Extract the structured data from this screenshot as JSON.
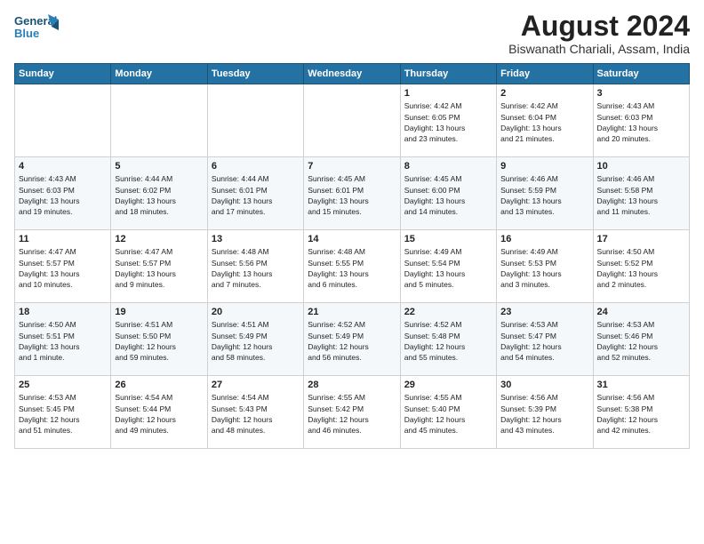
{
  "logo": {
    "line1": "General",
    "line2": "Blue"
  },
  "title": "August 2024",
  "location": "Biswanath Chariali, Assam, India",
  "days_of_week": [
    "Sunday",
    "Monday",
    "Tuesday",
    "Wednesday",
    "Thursday",
    "Friday",
    "Saturday"
  ],
  "weeks": [
    [
      {
        "day": "",
        "info": ""
      },
      {
        "day": "",
        "info": ""
      },
      {
        "day": "",
        "info": ""
      },
      {
        "day": "",
        "info": ""
      },
      {
        "day": "1",
        "info": "Sunrise: 4:42 AM\nSunset: 6:05 PM\nDaylight: 13 hours\nand 23 minutes."
      },
      {
        "day": "2",
        "info": "Sunrise: 4:42 AM\nSunset: 6:04 PM\nDaylight: 13 hours\nand 21 minutes."
      },
      {
        "day": "3",
        "info": "Sunrise: 4:43 AM\nSunset: 6:03 PM\nDaylight: 13 hours\nand 20 minutes."
      }
    ],
    [
      {
        "day": "4",
        "info": "Sunrise: 4:43 AM\nSunset: 6:03 PM\nDaylight: 13 hours\nand 19 minutes."
      },
      {
        "day": "5",
        "info": "Sunrise: 4:44 AM\nSunset: 6:02 PM\nDaylight: 13 hours\nand 18 minutes."
      },
      {
        "day": "6",
        "info": "Sunrise: 4:44 AM\nSunset: 6:01 PM\nDaylight: 13 hours\nand 17 minutes."
      },
      {
        "day": "7",
        "info": "Sunrise: 4:45 AM\nSunset: 6:01 PM\nDaylight: 13 hours\nand 15 minutes."
      },
      {
        "day": "8",
        "info": "Sunrise: 4:45 AM\nSunset: 6:00 PM\nDaylight: 13 hours\nand 14 minutes."
      },
      {
        "day": "9",
        "info": "Sunrise: 4:46 AM\nSunset: 5:59 PM\nDaylight: 13 hours\nand 13 minutes."
      },
      {
        "day": "10",
        "info": "Sunrise: 4:46 AM\nSunset: 5:58 PM\nDaylight: 13 hours\nand 11 minutes."
      }
    ],
    [
      {
        "day": "11",
        "info": "Sunrise: 4:47 AM\nSunset: 5:57 PM\nDaylight: 13 hours\nand 10 minutes."
      },
      {
        "day": "12",
        "info": "Sunrise: 4:47 AM\nSunset: 5:57 PM\nDaylight: 13 hours\nand 9 minutes."
      },
      {
        "day": "13",
        "info": "Sunrise: 4:48 AM\nSunset: 5:56 PM\nDaylight: 13 hours\nand 7 minutes."
      },
      {
        "day": "14",
        "info": "Sunrise: 4:48 AM\nSunset: 5:55 PM\nDaylight: 13 hours\nand 6 minutes."
      },
      {
        "day": "15",
        "info": "Sunrise: 4:49 AM\nSunset: 5:54 PM\nDaylight: 13 hours\nand 5 minutes."
      },
      {
        "day": "16",
        "info": "Sunrise: 4:49 AM\nSunset: 5:53 PM\nDaylight: 13 hours\nand 3 minutes."
      },
      {
        "day": "17",
        "info": "Sunrise: 4:50 AM\nSunset: 5:52 PM\nDaylight: 13 hours\nand 2 minutes."
      }
    ],
    [
      {
        "day": "18",
        "info": "Sunrise: 4:50 AM\nSunset: 5:51 PM\nDaylight: 13 hours\nand 1 minute."
      },
      {
        "day": "19",
        "info": "Sunrise: 4:51 AM\nSunset: 5:50 PM\nDaylight: 12 hours\nand 59 minutes."
      },
      {
        "day": "20",
        "info": "Sunrise: 4:51 AM\nSunset: 5:49 PM\nDaylight: 12 hours\nand 58 minutes."
      },
      {
        "day": "21",
        "info": "Sunrise: 4:52 AM\nSunset: 5:49 PM\nDaylight: 12 hours\nand 56 minutes."
      },
      {
        "day": "22",
        "info": "Sunrise: 4:52 AM\nSunset: 5:48 PM\nDaylight: 12 hours\nand 55 minutes."
      },
      {
        "day": "23",
        "info": "Sunrise: 4:53 AM\nSunset: 5:47 PM\nDaylight: 12 hours\nand 54 minutes."
      },
      {
        "day": "24",
        "info": "Sunrise: 4:53 AM\nSunset: 5:46 PM\nDaylight: 12 hours\nand 52 minutes."
      }
    ],
    [
      {
        "day": "25",
        "info": "Sunrise: 4:53 AM\nSunset: 5:45 PM\nDaylight: 12 hours\nand 51 minutes."
      },
      {
        "day": "26",
        "info": "Sunrise: 4:54 AM\nSunset: 5:44 PM\nDaylight: 12 hours\nand 49 minutes."
      },
      {
        "day": "27",
        "info": "Sunrise: 4:54 AM\nSunset: 5:43 PM\nDaylight: 12 hours\nand 48 minutes."
      },
      {
        "day": "28",
        "info": "Sunrise: 4:55 AM\nSunset: 5:42 PM\nDaylight: 12 hours\nand 46 minutes."
      },
      {
        "day": "29",
        "info": "Sunrise: 4:55 AM\nSunset: 5:40 PM\nDaylight: 12 hours\nand 45 minutes."
      },
      {
        "day": "30",
        "info": "Sunrise: 4:56 AM\nSunset: 5:39 PM\nDaylight: 12 hours\nand 43 minutes."
      },
      {
        "day": "31",
        "info": "Sunrise: 4:56 AM\nSunset: 5:38 PM\nDaylight: 12 hours\nand 42 minutes."
      }
    ]
  ]
}
